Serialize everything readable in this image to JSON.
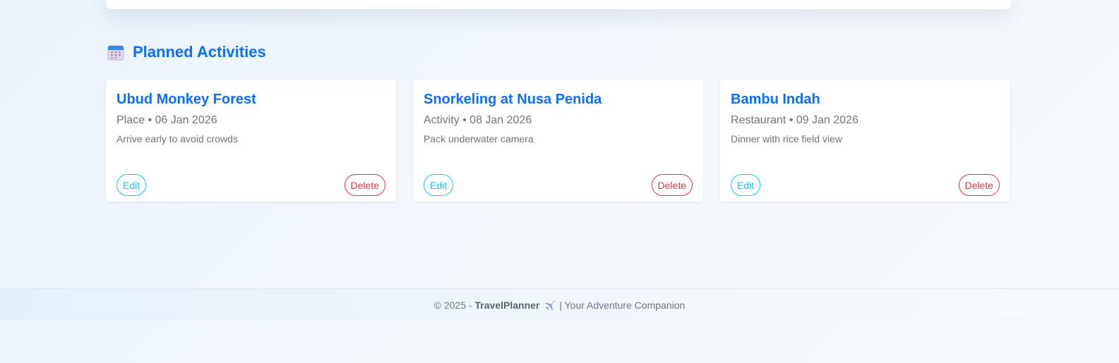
{
  "section": {
    "title": "Planned Activities",
    "icon": "calendar-icon"
  },
  "activities": [
    {
      "title": "Ubud Monkey Forest",
      "meta": "Place • 06 Jan 2026",
      "note": "Arrive early to avoid crowds",
      "edit_label": "Edit",
      "delete_label": "Delete"
    },
    {
      "title": "Snorkeling at Nusa Penida",
      "meta": "Activity • 08 Jan 2026",
      "note": "Pack underwater camera",
      "edit_label": "Edit",
      "delete_label": "Delete"
    },
    {
      "title": "Bambu Indah",
      "meta": "Restaurant • 09 Jan 2026",
      "note": "Dinner with rice field view",
      "edit_label": "Edit",
      "delete_label": "Delete"
    }
  ],
  "footer": {
    "copyright": "© 2025 -",
    "brand": "TravelPlanner",
    "icon": "airplane-icon",
    "tagline": "| Your Adventure Companion"
  },
  "colors": {
    "primary": "#0d6efd",
    "edit": "#0dcaf0",
    "delete": "#dc3545",
    "muted": "#6c757d"
  }
}
